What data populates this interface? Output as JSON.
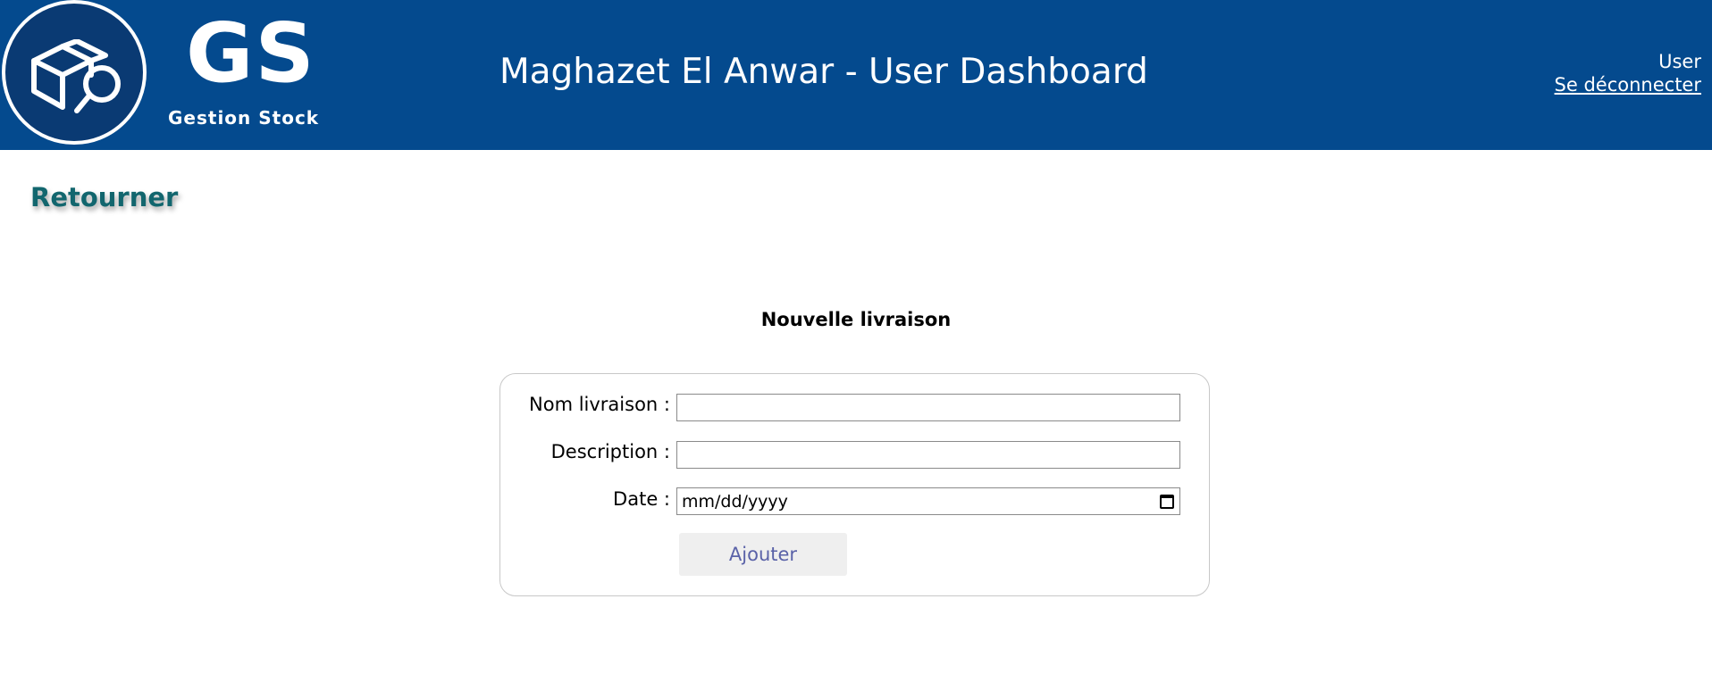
{
  "header": {
    "logo_text": "GS",
    "logo_subtitle": "Gestion Stock",
    "title": "Maghazet El Anwar - User Dashboard",
    "user_label": "User",
    "logout_label": "Se déconnecter",
    "background_color": "#044a8e"
  },
  "back_link": {
    "label": "Retourner",
    "color": "#12666e"
  },
  "form": {
    "title": "Nouvelle livraison",
    "fields": [
      {
        "label": "Nom livraison :",
        "value": "",
        "type": "text"
      },
      {
        "label": "Description :",
        "value": "",
        "type": "text"
      },
      {
        "label": "Date :",
        "value": "mm/dd/yyyy",
        "type": "date",
        "icon": "calendar-icon"
      }
    ],
    "submit_label": "Ajouter"
  }
}
